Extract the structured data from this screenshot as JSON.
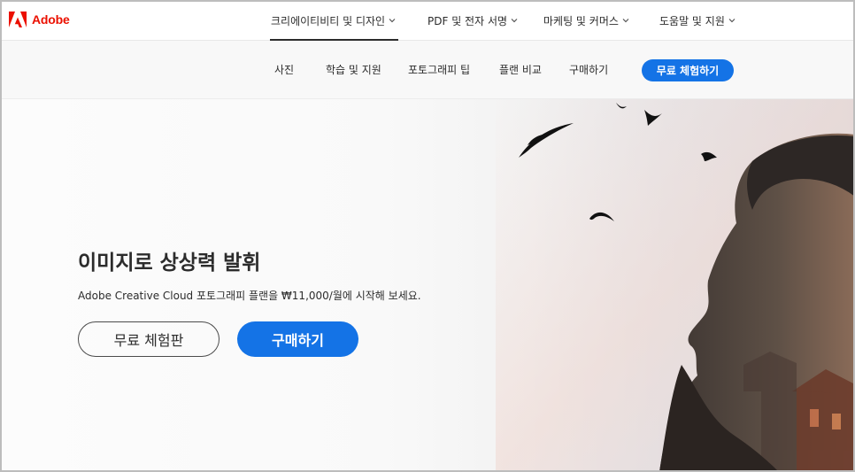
{
  "brand": {
    "name": "Adobe",
    "icon": "adobe-logo-icon",
    "color": "#eb1000"
  },
  "topnav": {
    "items": [
      {
        "label": "크리에이티비티 및 디자인",
        "active": true
      },
      {
        "label": "PDF 및 전자 서명"
      },
      {
        "label": "마케팅 및 커머스"
      },
      {
        "label": "도움말 및 지원"
      }
    ]
  },
  "subnav": {
    "items": [
      {
        "label": "사진"
      },
      {
        "label": "학습 및 지원"
      },
      {
        "label": "포토그래피 팁"
      },
      {
        "label": "플랜 비교"
      },
      {
        "label": "구매하기"
      }
    ],
    "cta": "무료 체험하기"
  },
  "hero": {
    "title": "이미지로 상상력 발휘",
    "subtitle": "Adobe Creative Cloud 포토그래피 플랜을 ₩11,000/월에 시작해 보세요.",
    "secondary_button": "무료 체험판",
    "primary_button": "구매하기",
    "accent_color": "#1473e6"
  }
}
